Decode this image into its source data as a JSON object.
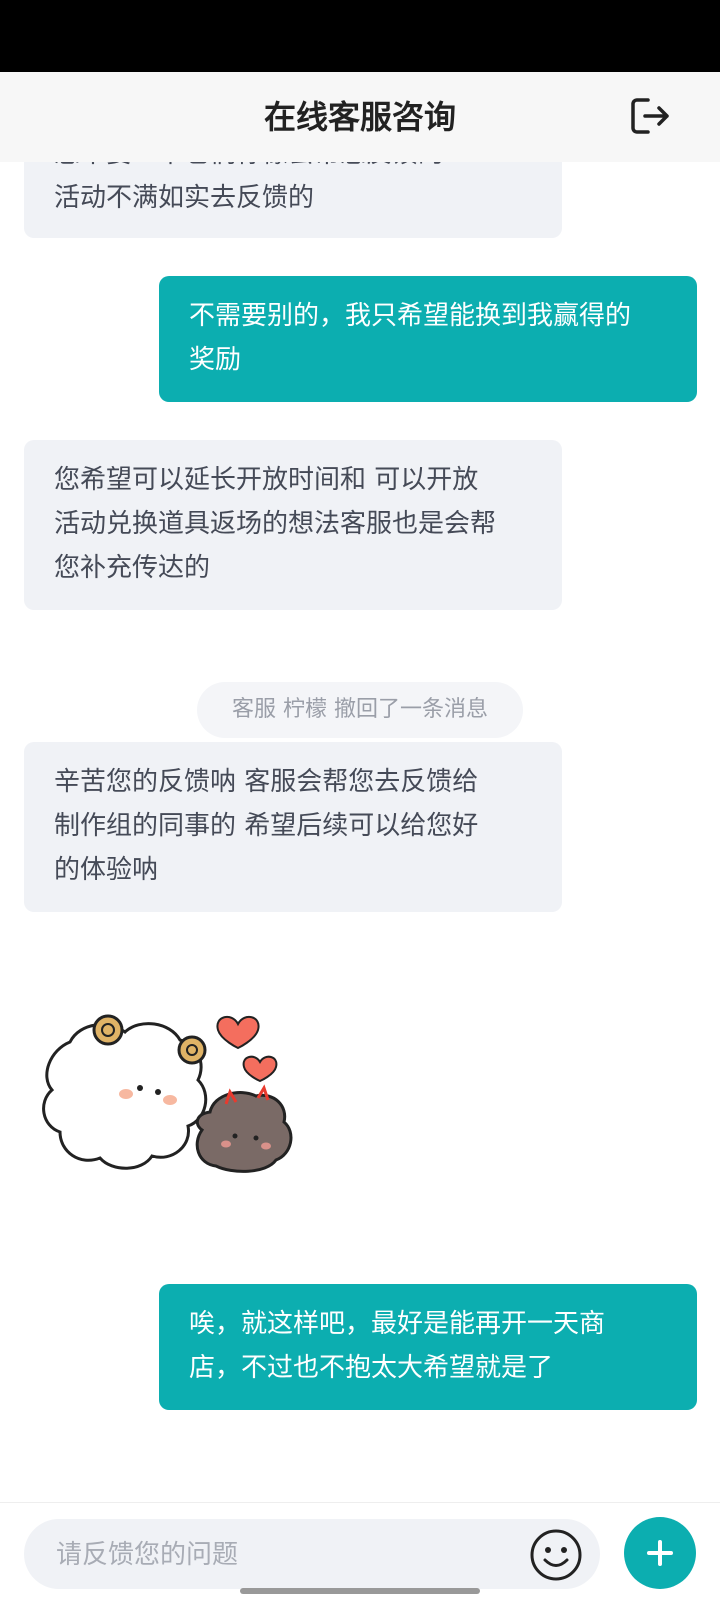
{
  "header": {
    "title": "在线客服咨询",
    "exit_icon": "exit-icon"
  },
  "messages": [
    {
      "side": "in",
      "text": "您不要一下它们柠檬会帮您反馈的\n活动不满如实去反馈的"
    },
    {
      "side": "out",
      "text": "不需要别的，我只希望能换到我赢得的\n奖励"
    },
    {
      "side": "in",
      "text": "您希望可以延长开放时间和 可以开放\n活动兑换道具返场的想法客服也是会帮\n您补充传达的"
    },
    {
      "side": "in",
      "text": "辛苦您的反馈呐 客服会帮您去反馈给\n制作组的同事的 希望后续可以给您好\n的体验呐"
    },
    {
      "side": "out",
      "text": "唉，就这样吧，最好是能再开一天商\n店，不过也不抱太大希望就是了"
    }
  ],
  "notice": "客服 柠檬 撤回了一条消息",
  "composer": {
    "placeholder": "请反馈您的问题",
    "emoji_icon": "smiley-icon",
    "plus_icon": "plus-icon"
  },
  "colors": {
    "accent": "#0caeb0",
    "incoming_bubble": "#f0f2f6",
    "header_bg": "#f7f7f7"
  }
}
